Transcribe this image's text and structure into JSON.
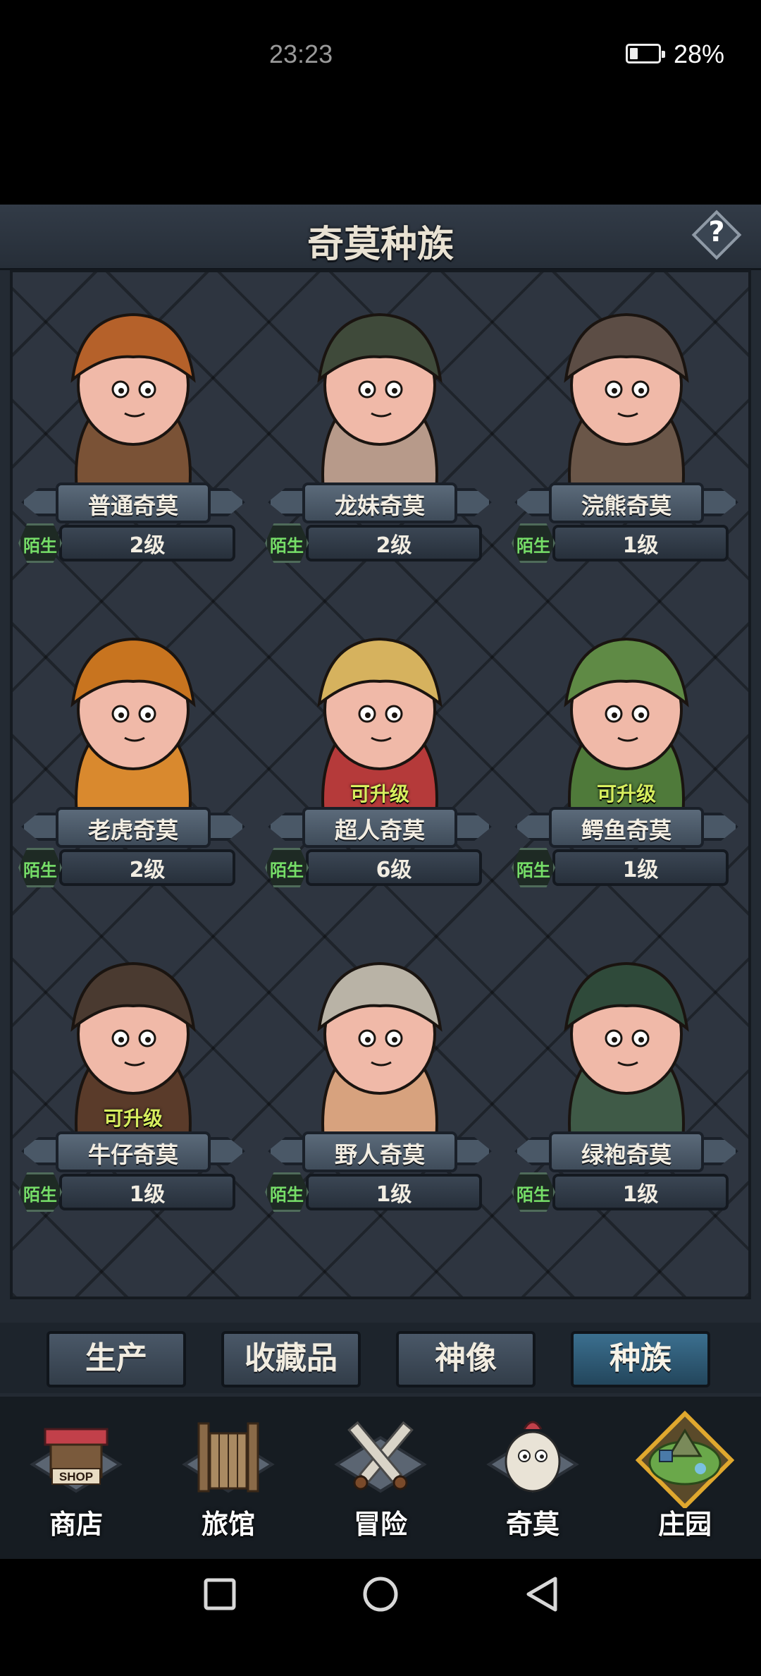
{
  "status_bar": {
    "time": "23:23",
    "battery": "28%",
    "battery_level": 0.28
  },
  "header": {
    "title": "奇莫种族",
    "help": "?"
  },
  "cards": [
    {
      "name": "普通奇莫",
      "level": "2级",
      "tag": "陌生",
      "upgrade": "",
      "body_color": "#7a5236",
      "hat_color": "#b5612a"
    },
    {
      "name": "龙妹奇莫",
      "level": "2级",
      "tag": "陌生",
      "upgrade": "",
      "body_color": "#b79a8a",
      "hat_color": "#3f4a3a"
    },
    {
      "name": "浣熊奇莫",
      "level": "1级",
      "tag": "陌生",
      "upgrade": "",
      "body_color": "#6a5648",
      "hat_color": "#5c4d45"
    },
    {
      "name": "老虎奇莫",
      "level": "2级",
      "tag": "陌生",
      "upgrade": "",
      "body_color": "#d9892e",
      "hat_color": "#c8741f"
    },
    {
      "name": "超人奇莫",
      "level": "6级",
      "tag": "陌生",
      "upgrade": "可升级",
      "body_color": "#b53a3a",
      "hat_color": "#d6b25e"
    },
    {
      "name": "鳄鱼奇莫",
      "level": "1级",
      "tag": "陌生",
      "upgrade": "可升级",
      "body_color": "#4f7a3a",
      "hat_color": "#5f8a45"
    },
    {
      "name": "牛仔奇莫",
      "level": "1级",
      "tag": "陌生",
      "upgrade": "可升级",
      "body_color": "#5a3b2a",
      "hat_color": "#4a3a30"
    },
    {
      "name": "野人奇莫",
      "level": "1级",
      "tag": "陌生",
      "upgrade": "",
      "body_color": "#d7a27e",
      "hat_color": "#b9b3a6"
    },
    {
      "name": "绿袍奇莫",
      "level": "1级",
      "tag": "陌生",
      "upgrade": "",
      "body_color": "#3f5a47",
      "hat_color": "#2f4a3a"
    }
  ],
  "tabs": [
    {
      "label": "生产",
      "active": false
    },
    {
      "label": "收藏品",
      "active": false
    },
    {
      "label": "神像",
      "active": false
    },
    {
      "label": "种族",
      "active": true
    }
  ],
  "nav": [
    {
      "label": "商店",
      "icon": "shop-icon",
      "sign": "SHOP"
    },
    {
      "label": "旅馆",
      "icon": "inn-gate-icon"
    },
    {
      "label": "冒险",
      "icon": "crossed-swords-icon"
    },
    {
      "label": "奇莫",
      "icon": "chimo-face-icon"
    },
    {
      "label": "庄园",
      "icon": "floating-island-icon"
    }
  ],
  "colors": {
    "upgrade": "#d7ee5e",
    "tag": "#76de68",
    "active_tab": "#3b6f8f"
  }
}
